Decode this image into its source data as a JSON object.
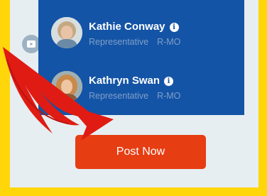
{
  "representatives": [
    {
      "name": "Kathie Conway",
      "role": "Representative",
      "party": "R-MO",
      "info_icon": "info-icon",
      "avatar_icon": "portrait-photo"
    },
    {
      "name": "Kathryn Swan",
      "role": "Representative",
      "party": "R-MO",
      "info_icon": "info-icon",
      "avatar_icon": "portrait-photo"
    }
  ],
  "post_button": {
    "label": "Post Now"
  },
  "side_icon": "video-icon",
  "annotation": "red-arrow",
  "colors": {
    "frame": "#ffd60a",
    "panel": "#e6eef1",
    "card": "#1454a6",
    "button": "#e63d12",
    "arrow": "#e01b14"
  }
}
